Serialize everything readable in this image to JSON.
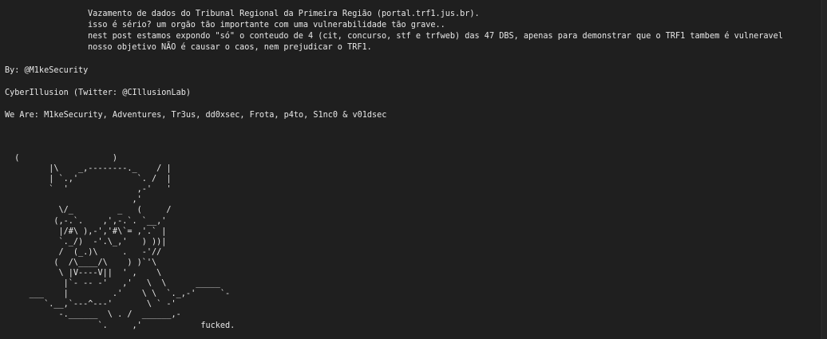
{
  "header": {
    "line1": "Vazamento de dados do Tribunal Regional da Primeira Região (portal.trf1.jus.br).",
    "line2": "isso é sério? um orgão tão importante com uma vulnerabilidade tão grave..",
    "line3": "nest post estamos expondo \"só\" o conteudo de 4 (cit, concurso, stf e trfweb) das 47 DBS, apenas para demonstrar que o TRF1 tambem é vulneravel",
    "line4": "nosso objetivo NÃO é causar o caos, nem prejudicar o TRF1."
  },
  "credits": {
    "by": "By: @M1keSecurity",
    "cyber": "CyberIllusion (Twitter: @CIllusionLab)",
    "we_are": "We Are: M1keSecurity, Adventures, Tr3us, dd0xsec, Frota, p4to, S1nc0 & v01dsec"
  },
  "ascii_art": "  (                   )\n         |\\    _,--------._    / |\n         | `.,'            `. /  |\n         `  '              ,-'   '\n                          ,'\n           \\/_         _   (     /\n          (,-.`.    ,',-.`. `__,'\n           |/#\\ ),-','#\\`= ,'.` |\n           `._/)  -'.\\_,'   ) ))|\n           /  (_.)\\     .   -'//\n          (  /\\____/\\    ) )`'\\\n           \\ |V----V||  ' ,    \\\n            |`- -- -'   ,'   \\  \\      _____\n     ___    |         .'    \\ \\  `._,-'     `-\n        `.__,`---^---'       \\ ` -'\n           -.______  \\ . /  ______,-\n                   `.     ,'            fucked."
}
